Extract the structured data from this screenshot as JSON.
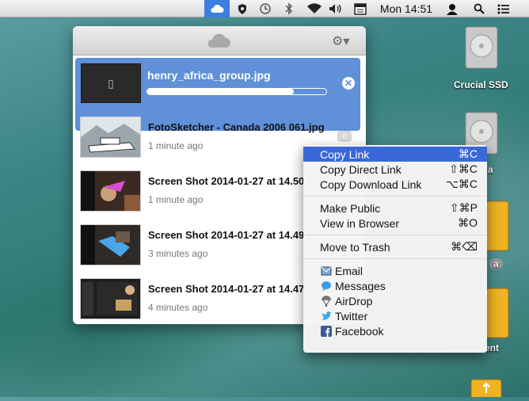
{
  "menubar": {
    "clock": "Mon 14:51",
    "icons": [
      "cloudapp-icon",
      "shield-icon",
      "time-machine-icon",
      "bluetooth-icon",
      "wifi-icon",
      "volume-icon",
      "calendar-icon",
      "user-icon",
      "search-icon",
      "list-icon"
    ]
  },
  "panel": {
    "uploading": {
      "name": "henry_africa_group.jpg",
      "progress": 0.82
    },
    "items": [
      {
        "title": "FotoSketcher - Canada 2006 061.jpg",
        "time": "1 minute ago",
        "badge": "0"
      },
      {
        "title": "Screen Shot 2014-01-27 at 14.50",
        "time": "1 minute ago"
      },
      {
        "title": "Screen Shot 2014-01-27 at 14.49",
        "time": "3 minutes ago"
      },
      {
        "title": "Screen Shot 2014-01-27 at 14.47",
        "time": "4 minutes ago"
      }
    ]
  },
  "menu": {
    "copy_link": "Copy Link",
    "copy_link_sc": "⌘C",
    "copy_direct": "Copy Direct Link",
    "copy_direct_sc": "⇧⌘C",
    "copy_download": "Copy Download Link",
    "copy_download_sc": "⌥⌘C",
    "make_public": "Make Public",
    "make_public_sc": "⇧⌘P",
    "view_browser": "View in Browser",
    "view_browser_sc": "⌘O",
    "trash": "Move to Trash",
    "trash_sc": "⌘⌫",
    "email": "Email",
    "messages": "Messages",
    "airdrop": "AirDrop",
    "twitter": "Twitter",
    "facebook": "Facebook"
  },
  "desktop": {
    "drive1": "Crucial SSD",
    "drive2_partial": "a",
    "drive3_partial": "a",
    "drive4_partial": "ent"
  }
}
